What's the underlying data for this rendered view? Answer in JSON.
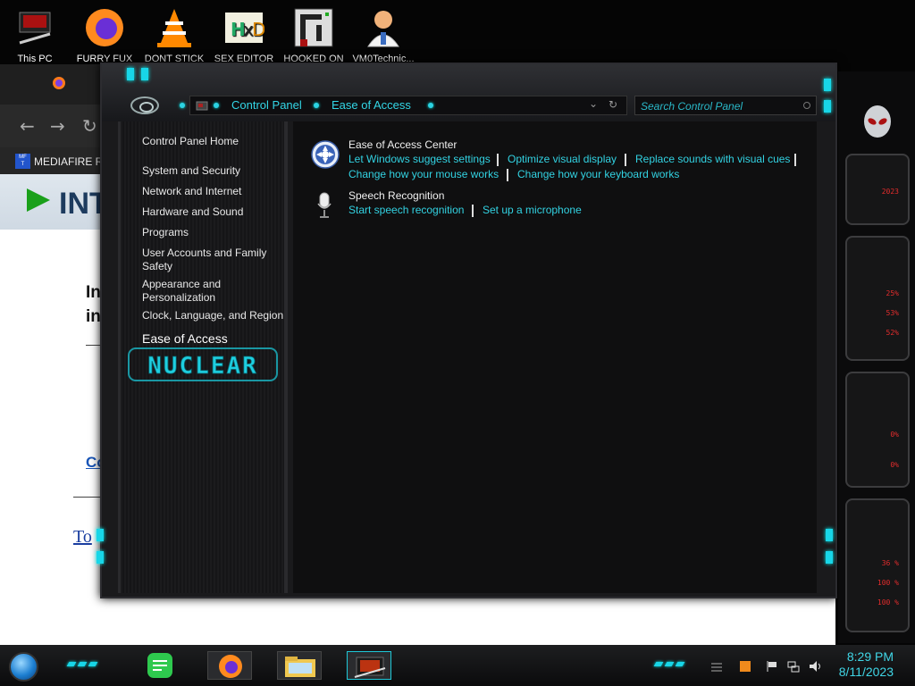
{
  "desktop_icons": [
    {
      "label": "This PC",
      "icon": "this-pc-icon"
    },
    {
      "label": "FURRY FUX",
      "icon": "firefox-icon"
    },
    {
      "label": "DONT STICK",
      "icon": "vlc-cone-icon"
    },
    {
      "label": "SEX EDITOR",
      "icon": "hxd-editor-icon"
    },
    {
      "label": "HOOKED ON",
      "icon": "app-icon"
    },
    {
      "label": "VM0Technic...",
      "icon": "doctor-avatar-icon"
    }
  ],
  "background_browser": {
    "bookmark": "MEDIAFIRE RC",
    "banner_text": "INTI",
    "partial_text_1": "In",
    "partial_text_2": "in",
    "partial_link": "Co",
    "partial_serif": "To"
  },
  "control_panel": {
    "breadcrumb": [
      "Control Panel",
      "Ease of Access"
    ],
    "search_placeholder": "Search Control Panel",
    "nav": {
      "home": "Control Panel Home",
      "items": [
        "System and Security",
        "Network and Internet",
        "Hardware and Sound",
        "Programs",
        "User Accounts and Family Safety",
        "Appearance and Personalization",
        "Clock, Language, and Region",
        "Ease of Access"
      ],
      "badge_text": "NUCLEAR"
    },
    "categories": [
      {
        "title": "Ease of Access Center",
        "icon": "ease-of-access-icon",
        "links": [
          "Let Windows suggest settings",
          "Optimize visual display",
          "Replace sounds with visual cues",
          "Change how your mouse works",
          "Change how your keyboard works"
        ]
      },
      {
        "title": "Speech Recognition",
        "icon": "microphone-icon",
        "links": [
          "Start speech recognition",
          "Set up a microphone"
        ]
      }
    ]
  },
  "sidebar_gadgets": {
    "year": "2023",
    "percents": [
      "25%",
      "53%",
      "52%",
      "0%",
      "0%",
      "36 %",
      "100 %",
      "100 %"
    ]
  },
  "taskbar": {
    "time": "8:29 PM",
    "date": "8/11/2023"
  },
  "colors": {
    "accent": "#32d2e2",
    "gadget_text": "#e32c2c"
  }
}
